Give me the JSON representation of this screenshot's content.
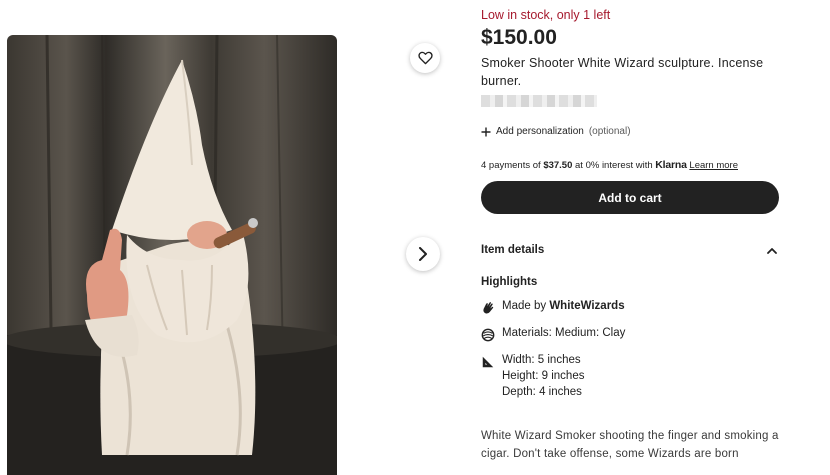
{
  "listing": {
    "stock_text": "Low in stock, only 1 left",
    "price": "$150.00",
    "title": "Smoker Shooter White Wizard sculpture. Incense burner.",
    "personalization": {
      "label": "Add personalization",
      "optional": "(optional)"
    },
    "klarna": {
      "prefix": "4 payments of",
      "amount": "$37.50",
      "middle": "at 0% interest with",
      "brand": "Klarna",
      "link": "Learn more"
    },
    "add_to_cart": "Add to cart"
  },
  "details": {
    "heading": "Item details",
    "highlights_heading": "Highlights",
    "made_by_prefix": "Made by",
    "maker": "WhiteWizards",
    "materials": "Materials: Medium: Clay",
    "width": "Width: 5 inches",
    "height": "Height: 9 inches",
    "depth": "Depth: 4 inches",
    "description": "White Wizard Smoker shooting the finger and smoking a cigar. Don't take offense, some Wizards are born"
  },
  "icons": {
    "favorite": "heart-icon",
    "next": "chevron-right-icon",
    "collapse": "chevron-up-icon",
    "add": "plus-icon",
    "maker": "hand-wave-icon",
    "materials": "materials-icon",
    "dimensions": "ruler-triangle-icon"
  },
  "colors": {
    "stock": "#a61a2e",
    "button": "#222222"
  }
}
